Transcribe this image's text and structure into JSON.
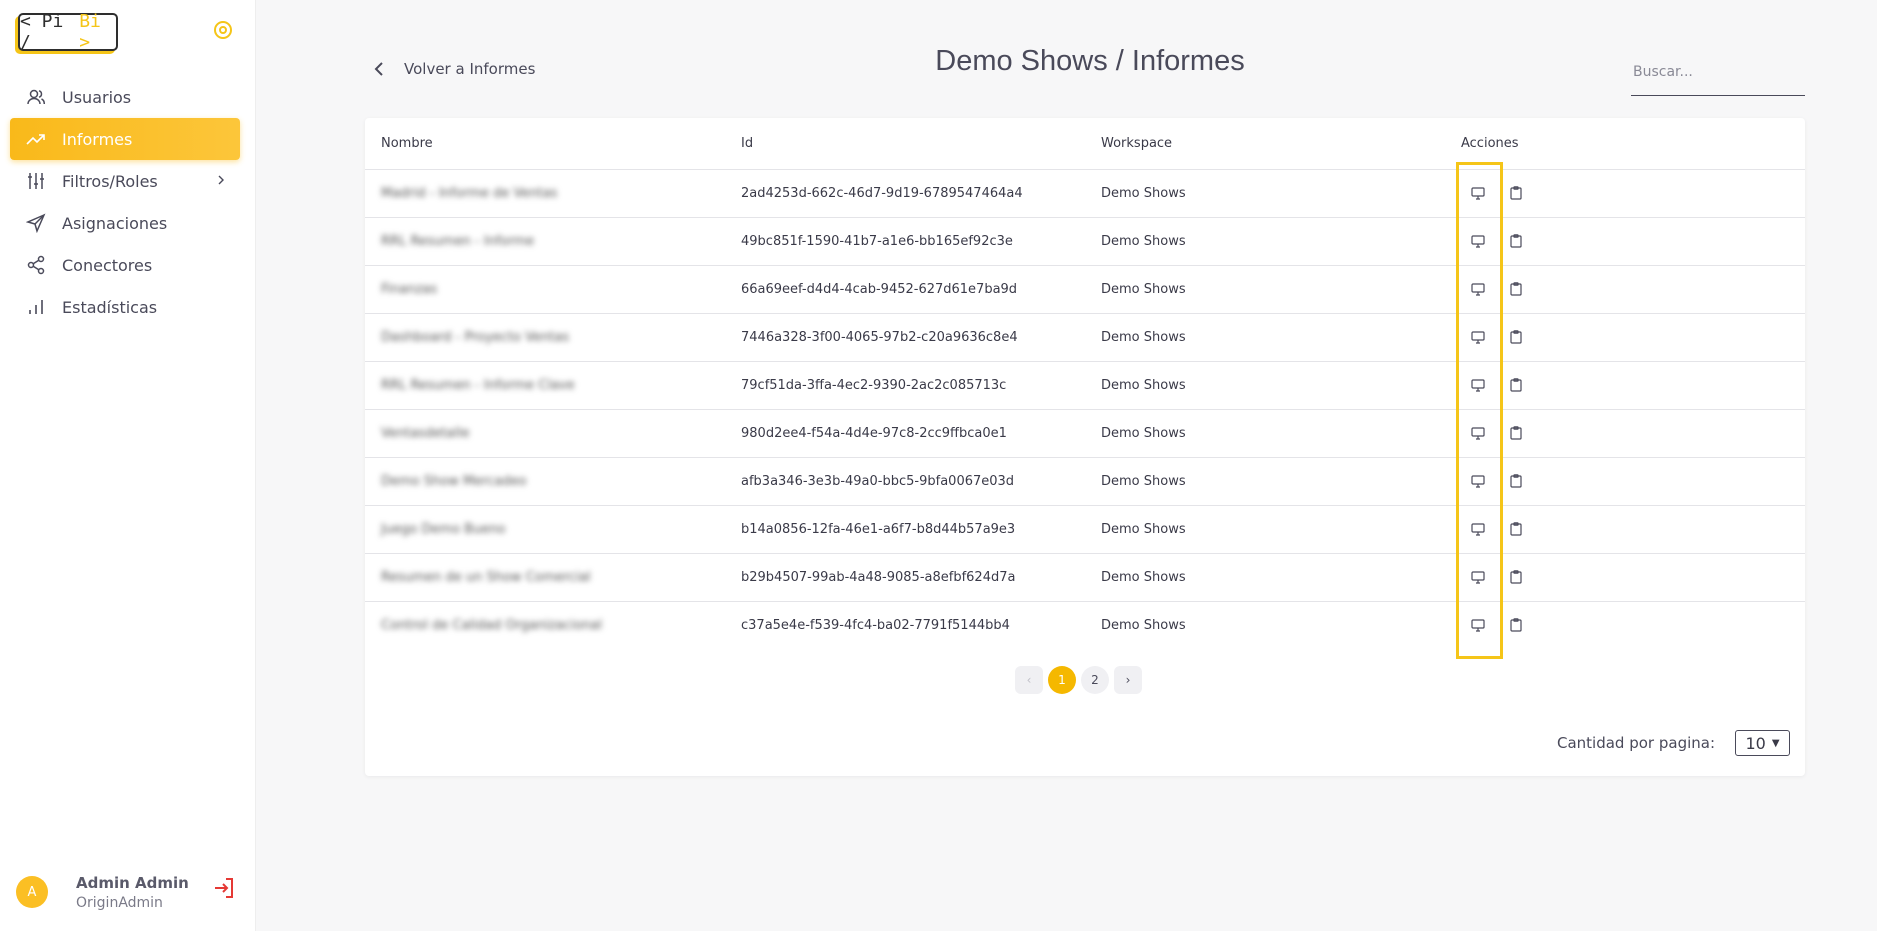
{
  "sidebar": {
    "logo": {
      "left": "< Pi /",
      "right": "Bi >"
    },
    "items": [
      {
        "label": "Usuarios",
        "icon": "users-icon"
      },
      {
        "label": "Informes",
        "icon": "trending-up-icon",
        "active": true
      },
      {
        "label": "Filtros/Roles",
        "icon": "sliders-icon",
        "has_submenu": true
      },
      {
        "label": "Asignaciones",
        "icon": "send-icon"
      },
      {
        "label": "Conectores",
        "icon": "share-icon"
      },
      {
        "label": "Estadísticas",
        "icon": "bar-chart-icon"
      }
    ],
    "user": {
      "initial": "A",
      "name": "Admin Admin",
      "role": "OriginAdmin"
    }
  },
  "header": {
    "back_label": "Volver a Informes",
    "title": "Demo Shows / Informes",
    "search_placeholder": "Buscar..."
  },
  "table": {
    "columns": [
      "Nombre",
      "Id",
      "Workspace",
      "Acciones"
    ],
    "rows": [
      {
        "name": "Madrid - Informe de Ventas",
        "id": "2ad4253d-662c-46d7-9d19-6789547464a4",
        "workspace": "Demo Shows"
      },
      {
        "name": "RRL Resumen - Informe",
        "id": "49bc851f-1590-41b7-a1e6-bb165ef92c3e",
        "workspace": "Demo Shows"
      },
      {
        "name": "Finanzas",
        "id": "66a69eef-d4d4-4cab-9452-627d61e7ba9d",
        "workspace": "Demo Shows"
      },
      {
        "name": "Dashboard - Proyecto Ventas",
        "id": "7446a328-3f00-4065-97b2-c20a9636c8e4",
        "workspace": "Demo Shows"
      },
      {
        "name": "RRL Resumen - Informe Clave",
        "id": "79cf51da-3ffa-4ec2-9390-2ac2c085713c",
        "workspace": "Demo Shows"
      },
      {
        "name": "Ventasdetalle",
        "id": "980d2ee4-f54a-4d4e-97c8-2cc9ffbca0e1",
        "workspace": "Demo Shows"
      },
      {
        "name": "Demo Show Mercadeo",
        "id": "afb3a346-3e3b-49a0-bbc5-9bfa0067e03d",
        "workspace": "Demo Shows"
      },
      {
        "name": "Juego Demo Bueno",
        "id": "b14a0856-12fa-46e1-a6f7-b8d44b57a9e3",
        "workspace": "Demo Shows"
      },
      {
        "name": "Resumen de un Show Comercial",
        "id": "b29b4507-99ab-4a48-9085-a8efbf624d7a",
        "workspace": "Demo Shows"
      },
      {
        "name": "Control de Calidad Organizacional",
        "id": "c37a5e4e-f539-4fc4-ba02-7791f5144bb4",
        "workspace": "Demo Shows"
      }
    ]
  },
  "pagination": {
    "prev": "‹",
    "pages": [
      "1",
      "2"
    ],
    "current": "1",
    "next": "›"
  },
  "per_page": {
    "label": "Cantidad por pagina:",
    "value": "10"
  },
  "colors": {
    "accent": "#f5b800",
    "highlight": "#f5c518",
    "logout": "#e53935"
  }
}
